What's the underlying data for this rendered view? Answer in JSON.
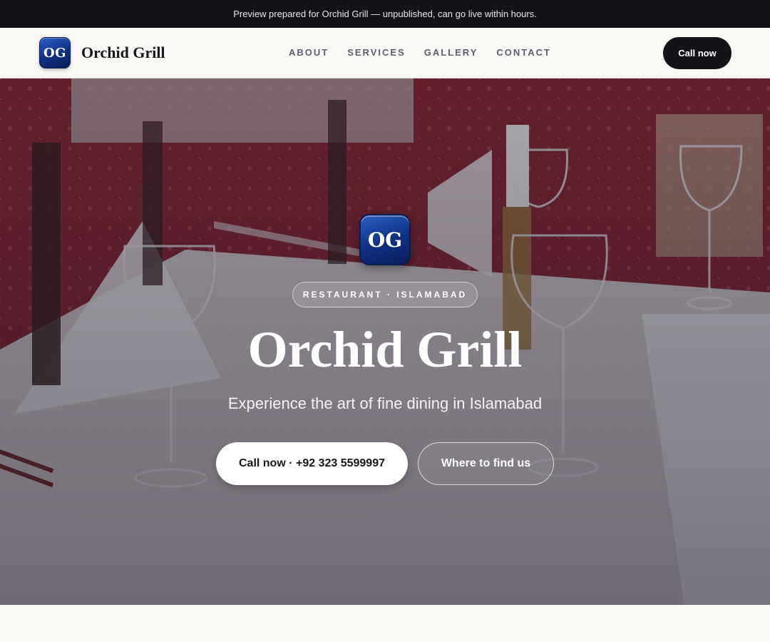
{
  "preview_banner": {
    "text": "Preview prepared for Orchid Grill — unpublished, can go live within hours."
  },
  "header": {
    "logo_initials": "OG",
    "brand_name": "Orchid Grill",
    "nav": [
      "ABOUT",
      "SERVICES",
      "GALLERY",
      "CONTACT"
    ],
    "cta_label": "Call now"
  },
  "hero": {
    "badge_initials": "OG",
    "tagline": "RESTAURANT · ISLAMABAD",
    "title": "Orchid Grill",
    "subtitle": "Experience the art of fine dining in Islamabad",
    "primary_button": "Call now · +92 323 5599997",
    "secondary_button": "Where to find us",
    "background_image": "restaurant table setting with wine glasses and napkins"
  },
  "colors": {
    "dark": "#121419",
    "logo_blue": "#0f2f80",
    "page_bg": "#f9f8f5",
    "nav_text": "#5b6070"
  }
}
